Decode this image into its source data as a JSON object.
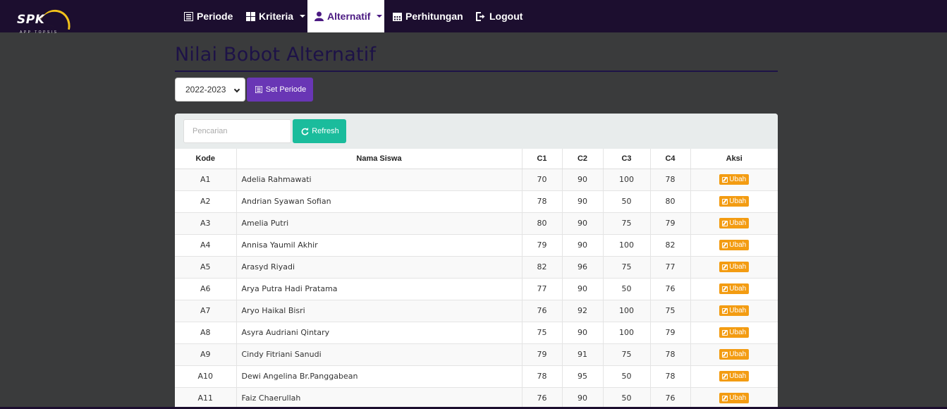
{
  "brand": {
    "logo_text": "SPK",
    "logo_sub": "APP TOPSIS"
  },
  "nav": {
    "items": [
      {
        "label": "Periode",
        "icon": "list-icon"
      },
      {
        "label": "Kriteria",
        "icon": "grid-icon"
      },
      {
        "label": "Alternatif",
        "icon": "user-icon"
      },
      {
        "label": "Perhitungan",
        "icon": "calendar-icon"
      },
      {
        "label": "Logout",
        "icon": "logout-icon"
      }
    ]
  },
  "page": {
    "title": "Nilai Bobot Alternatif"
  },
  "toolbar": {
    "period_value": "2022-2023",
    "set_label": "Set Periode"
  },
  "panel": {
    "search_placeholder": "Pencarian",
    "refresh_label": "Refresh"
  },
  "table": {
    "headers": [
      "Kode",
      "Nama Siswa",
      "C1",
      "C2",
      "C3",
      "C4",
      "Aksi"
    ],
    "action_label": "Ubah",
    "rows": [
      {
        "kode": "A1",
        "nama": "Adelia Rahmawati",
        "c1": "70",
        "c2": "90",
        "c3": "100",
        "c4": "78"
      },
      {
        "kode": "A2",
        "nama": "Andrian Syawan Sofian",
        "c1": "78",
        "c2": "90",
        "c3": "50",
        "c4": "80"
      },
      {
        "kode": "A3",
        "nama": "Amelia Putri",
        "c1": "80",
        "c2": "90",
        "c3": "75",
        "c4": "79"
      },
      {
        "kode": "A4",
        "nama": "Annisa Yaumil Akhir",
        "c1": "79",
        "c2": "90",
        "c3": "100",
        "c4": "82"
      },
      {
        "kode": "A5",
        "nama": "Arasyd Riyadi",
        "c1": "82",
        "c2": "96",
        "c3": "75",
        "c4": "77"
      },
      {
        "kode": "A6",
        "nama": "Arya Putra Hadi Pratama",
        "c1": "77",
        "c2": "90",
        "c3": "50",
        "c4": "76"
      },
      {
        "kode": "A7",
        "nama": "Aryo Haikal Bisri",
        "c1": "76",
        "c2": "92",
        "c3": "100",
        "c4": "75"
      },
      {
        "kode": "A8",
        "nama": "Asyra Audriani Qintary",
        "c1": "75",
        "c2": "90",
        "c3": "100",
        "c4": "79"
      },
      {
        "kode": "A9",
        "nama": "Cindy Fitriani Sanudi",
        "c1": "79",
        "c2": "91",
        "c3": "75",
        "c4": "78"
      },
      {
        "kode": "A10",
        "nama": "Dewi Angelina Br.Panggabean",
        "c1": "78",
        "c2": "95",
        "c3": "50",
        "c4": "78"
      },
      {
        "kode": "A11",
        "nama": "Faiz Chaerullah",
        "c1": "76",
        "c2": "90",
        "c3": "50",
        "c4": "76"
      }
    ]
  }
}
